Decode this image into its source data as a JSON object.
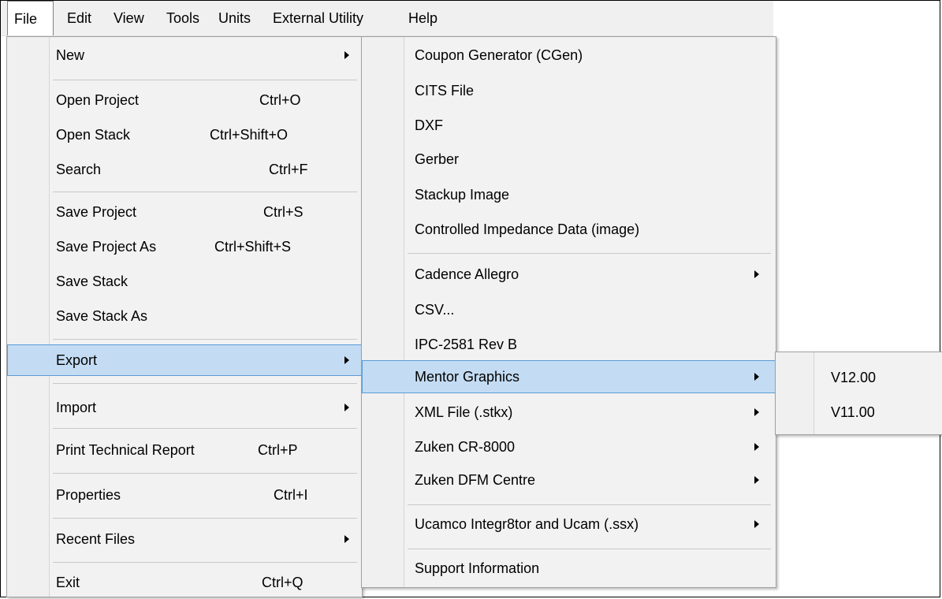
{
  "menubar": {
    "items": [
      {
        "label": "File"
      },
      {
        "label": "Edit"
      },
      {
        "label": "View"
      },
      {
        "label": "Tools"
      },
      {
        "label": "Units"
      },
      {
        "label": "External Utility"
      },
      {
        "label": "Help"
      }
    ]
  },
  "file_menu": {
    "new": {
      "label": "New"
    },
    "open_project": {
      "label": "Open Project",
      "shortcut": "Ctrl+O"
    },
    "open_stack": {
      "label": "Open Stack",
      "shortcut": "Ctrl+Shift+O"
    },
    "search": {
      "label": "Search",
      "shortcut": "Ctrl+F"
    },
    "save_project": {
      "label": "Save Project",
      "shortcut": "Ctrl+S"
    },
    "save_project_as": {
      "label": "Save Project As",
      "shortcut": "Ctrl+Shift+S"
    },
    "save_stack": {
      "label": "Save Stack"
    },
    "save_stack_as": {
      "label": "Save Stack As"
    },
    "export": {
      "label": "Export"
    },
    "import": {
      "label": "Import"
    },
    "print_report": {
      "label": "Print Technical Report",
      "shortcut": "Ctrl+P"
    },
    "properties": {
      "label": "Properties",
      "shortcut": "Ctrl+I"
    },
    "recent_files": {
      "label": "Recent Files"
    },
    "exit": {
      "label": "Exit",
      "shortcut": "Ctrl+Q"
    }
  },
  "export_menu": {
    "coupon": {
      "label": "Coupon Generator (CGen)"
    },
    "cits": {
      "label": "CITS File"
    },
    "dxf": {
      "label": "DXF"
    },
    "gerber": {
      "label": "Gerber"
    },
    "stackup_image": {
      "label": "Stackup Image"
    },
    "controlled_impedance": {
      "label": "Controlled Impedance Data (image)"
    },
    "cadence": {
      "label": "Cadence Allegro"
    },
    "csv": {
      "label": "CSV..."
    },
    "ipc": {
      "label": "IPC-2581 Rev B"
    },
    "mentor": {
      "label": "Mentor Graphics"
    },
    "xml": {
      "label": "XML File (.stkx)"
    },
    "zuken_cr": {
      "label": "Zuken CR-8000"
    },
    "zuken_dfm": {
      "label": "Zuken DFM Centre"
    },
    "ucamco": {
      "label": "Ucamco Integr8tor and Ucam (.ssx)"
    },
    "support": {
      "label": "Support Information"
    }
  },
  "mentor_menu": {
    "v12": {
      "label": "V12.00"
    },
    "v11": {
      "label": "V11.00"
    }
  },
  "colors": {
    "highlight_fill": "#c4dcf3",
    "highlight_border": "#5b9bd5",
    "menu_bg": "#f2f2f2"
  }
}
